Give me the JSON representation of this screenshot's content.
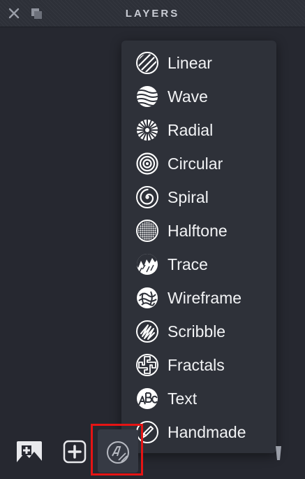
{
  "panel": {
    "title": "LAYERS"
  },
  "icons": {
    "close": "close-icon",
    "minimize": "minimize-icon",
    "add_image": "add-image-icon",
    "add_layer": "add-layer-icon",
    "generator": "generator-icon",
    "trash": "trash-icon"
  },
  "menu": {
    "items": [
      {
        "label": "Linear",
        "icon": "linear-icon"
      },
      {
        "label": "Wave",
        "icon": "wave-icon"
      },
      {
        "label": "Radial",
        "icon": "radial-icon"
      },
      {
        "label": "Circular",
        "icon": "circular-icon"
      },
      {
        "label": "Spiral",
        "icon": "spiral-icon"
      },
      {
        "label": "Halftone",
        "icon": "halftone-icon"
      },
      {
        "label": "Trace",
        "icon": "trace-icon"
      },
      {
        "label": "Wireframe",
        "icon": "wireframe-icon"
      },
      {
        "label": "Scribble",
        "icon": "scribble-icon"
      },
      {
        "label": "Fractals",
        "icon": "fractals-icon"
      },
      {
        "label": "Text",
        "icon": "text-icon"
      },
      {
        "label": "Handmade",
        "icon": "handmade-icon"
      }
    ]
  },
  "colors": {
    "background": "#262830",
    "menu": "#2e3139",
    "highlight": "#e51414",
    "text": "#f2f3f5"
  }
}
